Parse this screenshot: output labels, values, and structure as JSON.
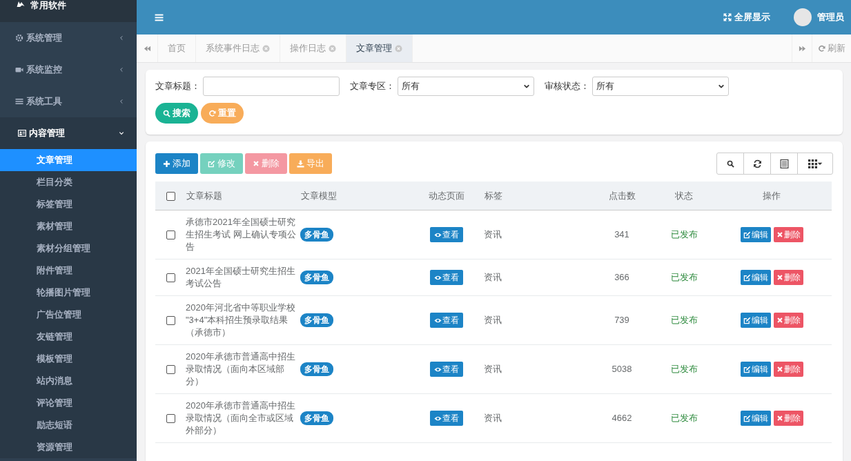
{
  "sidebar": {
    "brand": "常用软件",
    "items": [
      {
        "label": "系统管理",
        "expanded": false
      },
      {
        "label": "系统监控",
        "expanded": false
      },
      {
        "label": "系统工具",
        "expanded": false
      },
      {
        "label": "内容管理",
        "expanded": true,
        "children": [
          {
            "label": "文章管理",
            "selected": true
          },
          {
            "label": "栏目分类",
            "selected": false
          },
          {
            "label": "标签管理",
            "selected": false
          },
          {
            "label": "素材管理",
            "selected": false
          },
          {
            "label": "素材分组管理",
            "selected": false
          },
          {
            "label": "附件管理",
            "selected": false
          },
          {
            "label": "轮播图片管理",
            "selected": false
          },
          {
            "label": "广告位管理",
            "selected": false
          },
          {
            "label": "友链管理",
            "selected": false
          },
          {
            "label": "模板管理",
            "selected": false
          },
          {
            "label": "站内消息",
            "selected": false
          },
          {
            "label": "评论管理",
            "selected": false
          },
          {
            "label": "励志短语",
            "selected": false
          },
          {
            "label": "资源管理",
            "selected": false
          }
        ]
      }
    ]
  },
  "header": {
    "fullscreen": "全屏显示",
    "user": "管理员"
  },
  "tabs": [
    {
      "label": "首页",
      "closable": false,
      "selected": false
    },
    {
      "label": "系统事件日志",
      "closable": true,
      "selected": false
    },
    {
      "label": "操作日志",
      "closable": true,
      "selected": false
    },
    {
      "label": "文章管理",
      "closable": true,
      "selected": true
    }
  ],
  "refresh": "刷新",
  "search": {
    "fields": [
      {
        "label": "文章标题：",
        "kind": "text"
      },
      {
        "label": "文章专区：",
        "kind": "select",
        "value": "所有"
      },
      {
        "label": "审核状态：",
        "kind": "select",
        "value": "所有"
      }
    ],
    "buttons": [
      {
        "label": "搜索",
        "kind": "search"
      },
      {
        "label": "重置",
        "kind": "reset"
      }
    ]
  },
  "toolbar": [
    {
      "label": "添加",
      "kind": "add",
      "disabled": false
    },
    {
      "label": "修改",
      "kind": "edit",
      "disabled": true
    },
    {
      "label": "删除",
      "kind": "delete",
      "disabled": true
    },
    {
      "label": "导出",
      "kind": "export",
      "disabled": false
    }
  ],
  "table": {
    "all_checked": false,
    "columns": [
      "文章标题",
      "文章模型",
      "动态页面",
      "标签",
      "点击数",
      "状态",
      "操作"
    ],
    "rows": [
      {
        "checked": false,
        "title": "承德市2021年全国硕士研究生招生考试 网上确认专项公告",
        "model": "多骨鱼",
        "view": "查看",
        "tag": "资讯",
        "clicks": "341",
        "status": "已发布",
        "edit": "编辑",
        "delete": "删除"
      },
      {
        "checked": false,
        "title": "2021年全国硕士研究生招生考试公告",
        "model": "多骨鱼",
        "view": "查看",
        "tag": "资讯",
        "clicks": "366",
        "status": "已发布",
        "edit": "编辑",
        "delete": "删除"
      },
      {
        "checked": false,
        "title": "2020年河北省中等职业学校 \"3+4\"本科招生预录取结果（承德市）",
        "model": "多骨鱼",
        "view": "查看",
        "tag": "资讯",
        "clicks": "739",
        "status": "已发布",
        "edit": "编辑",
        "delete": "删除"
      },
      {
        "checked": false,
        "title": "2020年承德市普通高中招生录取情况（面向本区域部分）",
        "model": "多骨鱼",
        "view": "查看",
        "tag": "资讯",
        "clicks": "5038",
        "status": "已发布",
        "edit": "编辑",
        "delete": "删除"
      },
      {
        "checked": false,
        "title": "2020年承德市普通高中招生录取情况（面向全市或区域外部分）",
        "model": "多骨鱼",
        "view": "查看",
        "tag": "资讯",
        "clicks": "4662",
        "status": "已发布",
        "edit": "编辑",
        "delete": "删除"
      }
    ]
  }
}
